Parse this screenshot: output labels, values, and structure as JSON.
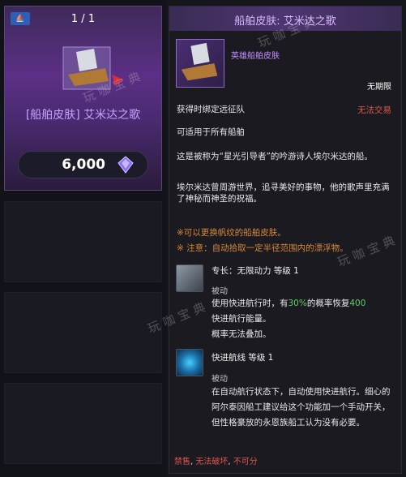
{
  "card": {
    "counter": "1 / 1",
    "title": "[船舶皮肤] 艾米达之歌",
    "price": "6,000",
    "badge_icon": "ship-badge-icon",
    "currency_icon": "crystal-currency-icon"
  },
  "tooltip": {
    "title": "船舶皮肤: 艾米达之歌",
    "item_name": "英雄船舶皮肤",
    "duration": "无期限",
    "bind": "获得时绑定远征队",
    "trade": "无法交易",
    "usable": "可适用于所有船舶",
    "description_1": "这是被称为“星光引导者”的吟游诗人埃尔米达的船。",
    "description_2": "埃尔米达曾周游世界，追寻美好的事物，他的歌声里充满了神秘而神圣的祝福。",
    "note_1": "※可以更换帆纹的船舶皮肤。",
    "note_2_prefix": "※ 注意：",
    "note_2_body": "自动拾取一定半径范围内的漂浮物。",
    "skills": [
      {
        "name": "专长：无限动力 等级 1",
        "type": "被动",
        "desc_part_1": "使用快进航行时，有",
        "desc_highlight": "30%",
        "desc_part_2": "的概率恢复",
        "desc_value": "400",
        "desc_part_3": "快进航行能量。",
        "desc_part_4": "概率无法叠加。"
      },
      {
        "name": "快进航线 等级 1",
        "type": "被动",
        "desc": "在自动航行状态下，自动使用快进航行。细心的阿尔泰因船工建议给这个功能加一个手动开关，但性格豪放的永恩族船工认为没有必要。"
      }
    ],
    "footer": {
      "flag_1": "禁售",
      "flag_2": "无法破坏",
      "flag_3": "不可分"
    }
  },
  "watermark": "玩咖宝典",
  "colors": {
    "rare_purple": "#c090ff",
    "warning_red": "#e0584f",
    "note_orange": "#d78a3a",
    "value_green": "#5fd06a"
  }
}
